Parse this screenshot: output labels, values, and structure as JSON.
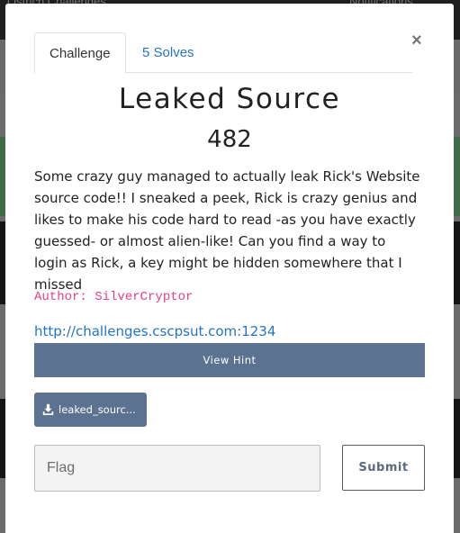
{
  "background": {
    "nav_left_text": "Ostrich  Challenges",
    "nav_right_text": "Notifications"
  },
  "modal": {
    "tabs": [
      {
        "label": "Challenge"
      },
      {
        "label": "5 Solves"
      }
    ],
    "close_glyph": "×",
    "title": "Leaked Source",
    "value": "482",
    "description": "Some crazy guy managed to actually leak Rick's Website source code!! I sneaked a peek, Rick is crazy genius and likes to make his code hard to read -as you have exactly guessed- or almost alien-like! Can you find a way to login as Rick, a key might be hidden somewhere that I missed",
    "author": "Author: SilverCryptor",
    "link": "http://challenges.cscpsut.com:1234",
    "hint_label": "View Hint",
    "file_label": "leaked_sourc...",
    "flag_placeholder": "Flag",
    "submit_label": "Submit"
  },
  "colors": {
    "accent": "#5b7290",
    "link": "#2574c4",
    "author": "#e83e8c"
  }
}
